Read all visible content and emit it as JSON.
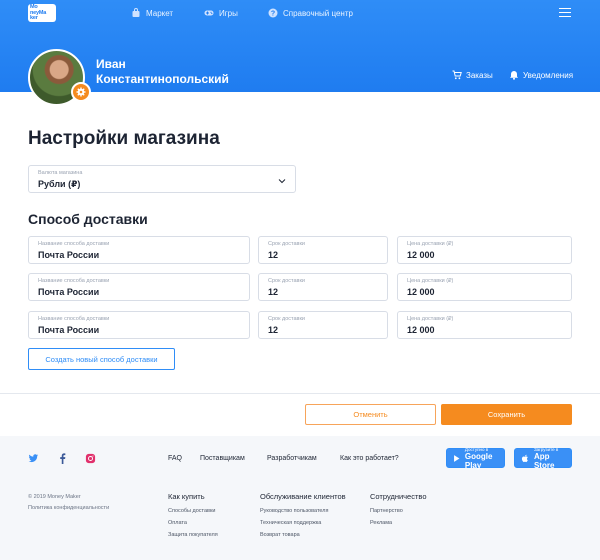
{
  "nav": {
    "logo": [
      "Mo",
      "ney",
      "Ma",
      "ker"
    ],
    "items": [
      {
        "label": "Маркет",
        "icon": "bag-icon"
      },
      {
        "label": "Игры",
        "icon": "gamepad-icon"
      },
      {
        "label": "Справочный центр",
        "icon": "help-icon"
      }
    ]
  },
  "profile": {
    "first_name": "Иван",
    "last_name": "Константинопольский",
    "orders_label": "Заказы",
    "notifications_label": "Уведомления"
  },
  "page": {
    "title": "Настройки магазина",
    "currency": {
      "label": "Валюта магазина",
      "value": "Рубли (₽)"
    },
    "delivery_title": "Способ доставки",
    "delivery_rows": [
      {
        "name_label": "Название способа доставки",
        "name": "Почта России",
        "term_label": "Срок доставки",
        "term": "12",
        "price_label": "Цена доставки (₽)",
        "price": "12 000"
      },
      {
        "name_label": "Название способа доставки",
        "name": "Почта России",
        "term_label": "Срок доставки",
        "term": "12",
        "price_label": "Цена доставки (₽)",
        "price": "12 000"
      },
      {
        "name_label": "Название способа доставки",
        "name": "Почта России",
        "term_label": "Срок доставки",
        "term": "12",
        "price_label": "Цена доставки (₽)",
        "price": "12 000"
      }
    ],
    "add_delivery_label": "Создать новый способ доставки",
    "cancel_label": "Отменить",
    "save_label": "Сохранить"
  },
  "footer": {
    "links": [
      "FAQ",
      "Поставщикам",
      "Разработчикам",
      "Как это работает?"
    ],
    "google_play": {
      "small": "Доступно в",
      "big": "Google Play"
    },
    "app_store": {
      "small": "Загрузите в",
      "big": "App Store"
    },
    "copyright": "© 2019 Money Maker",
    "privacy": "Политика конфиденциальности",
    "columns": [
      {
        "title": "Как купить",
        "items": [
          "Способы доставки",
          "Оплата",
          "Защита покупателя"
        ]
      },
      {
        "title": "Обслуживание клиентов",
        "items": [
          "Руководство пользователя",
          "Техническая поддержка",
          "Возврат товара"
        ]
      },
      {
        "title": "Сотрудничество",
        "items": [
          "Партнерство",
          "Реклама"
        ]
      }
    ]
  },
  "colors": {
    "primary": "#2f8df7",
    "accent": "#f58b1f"
  }
}
